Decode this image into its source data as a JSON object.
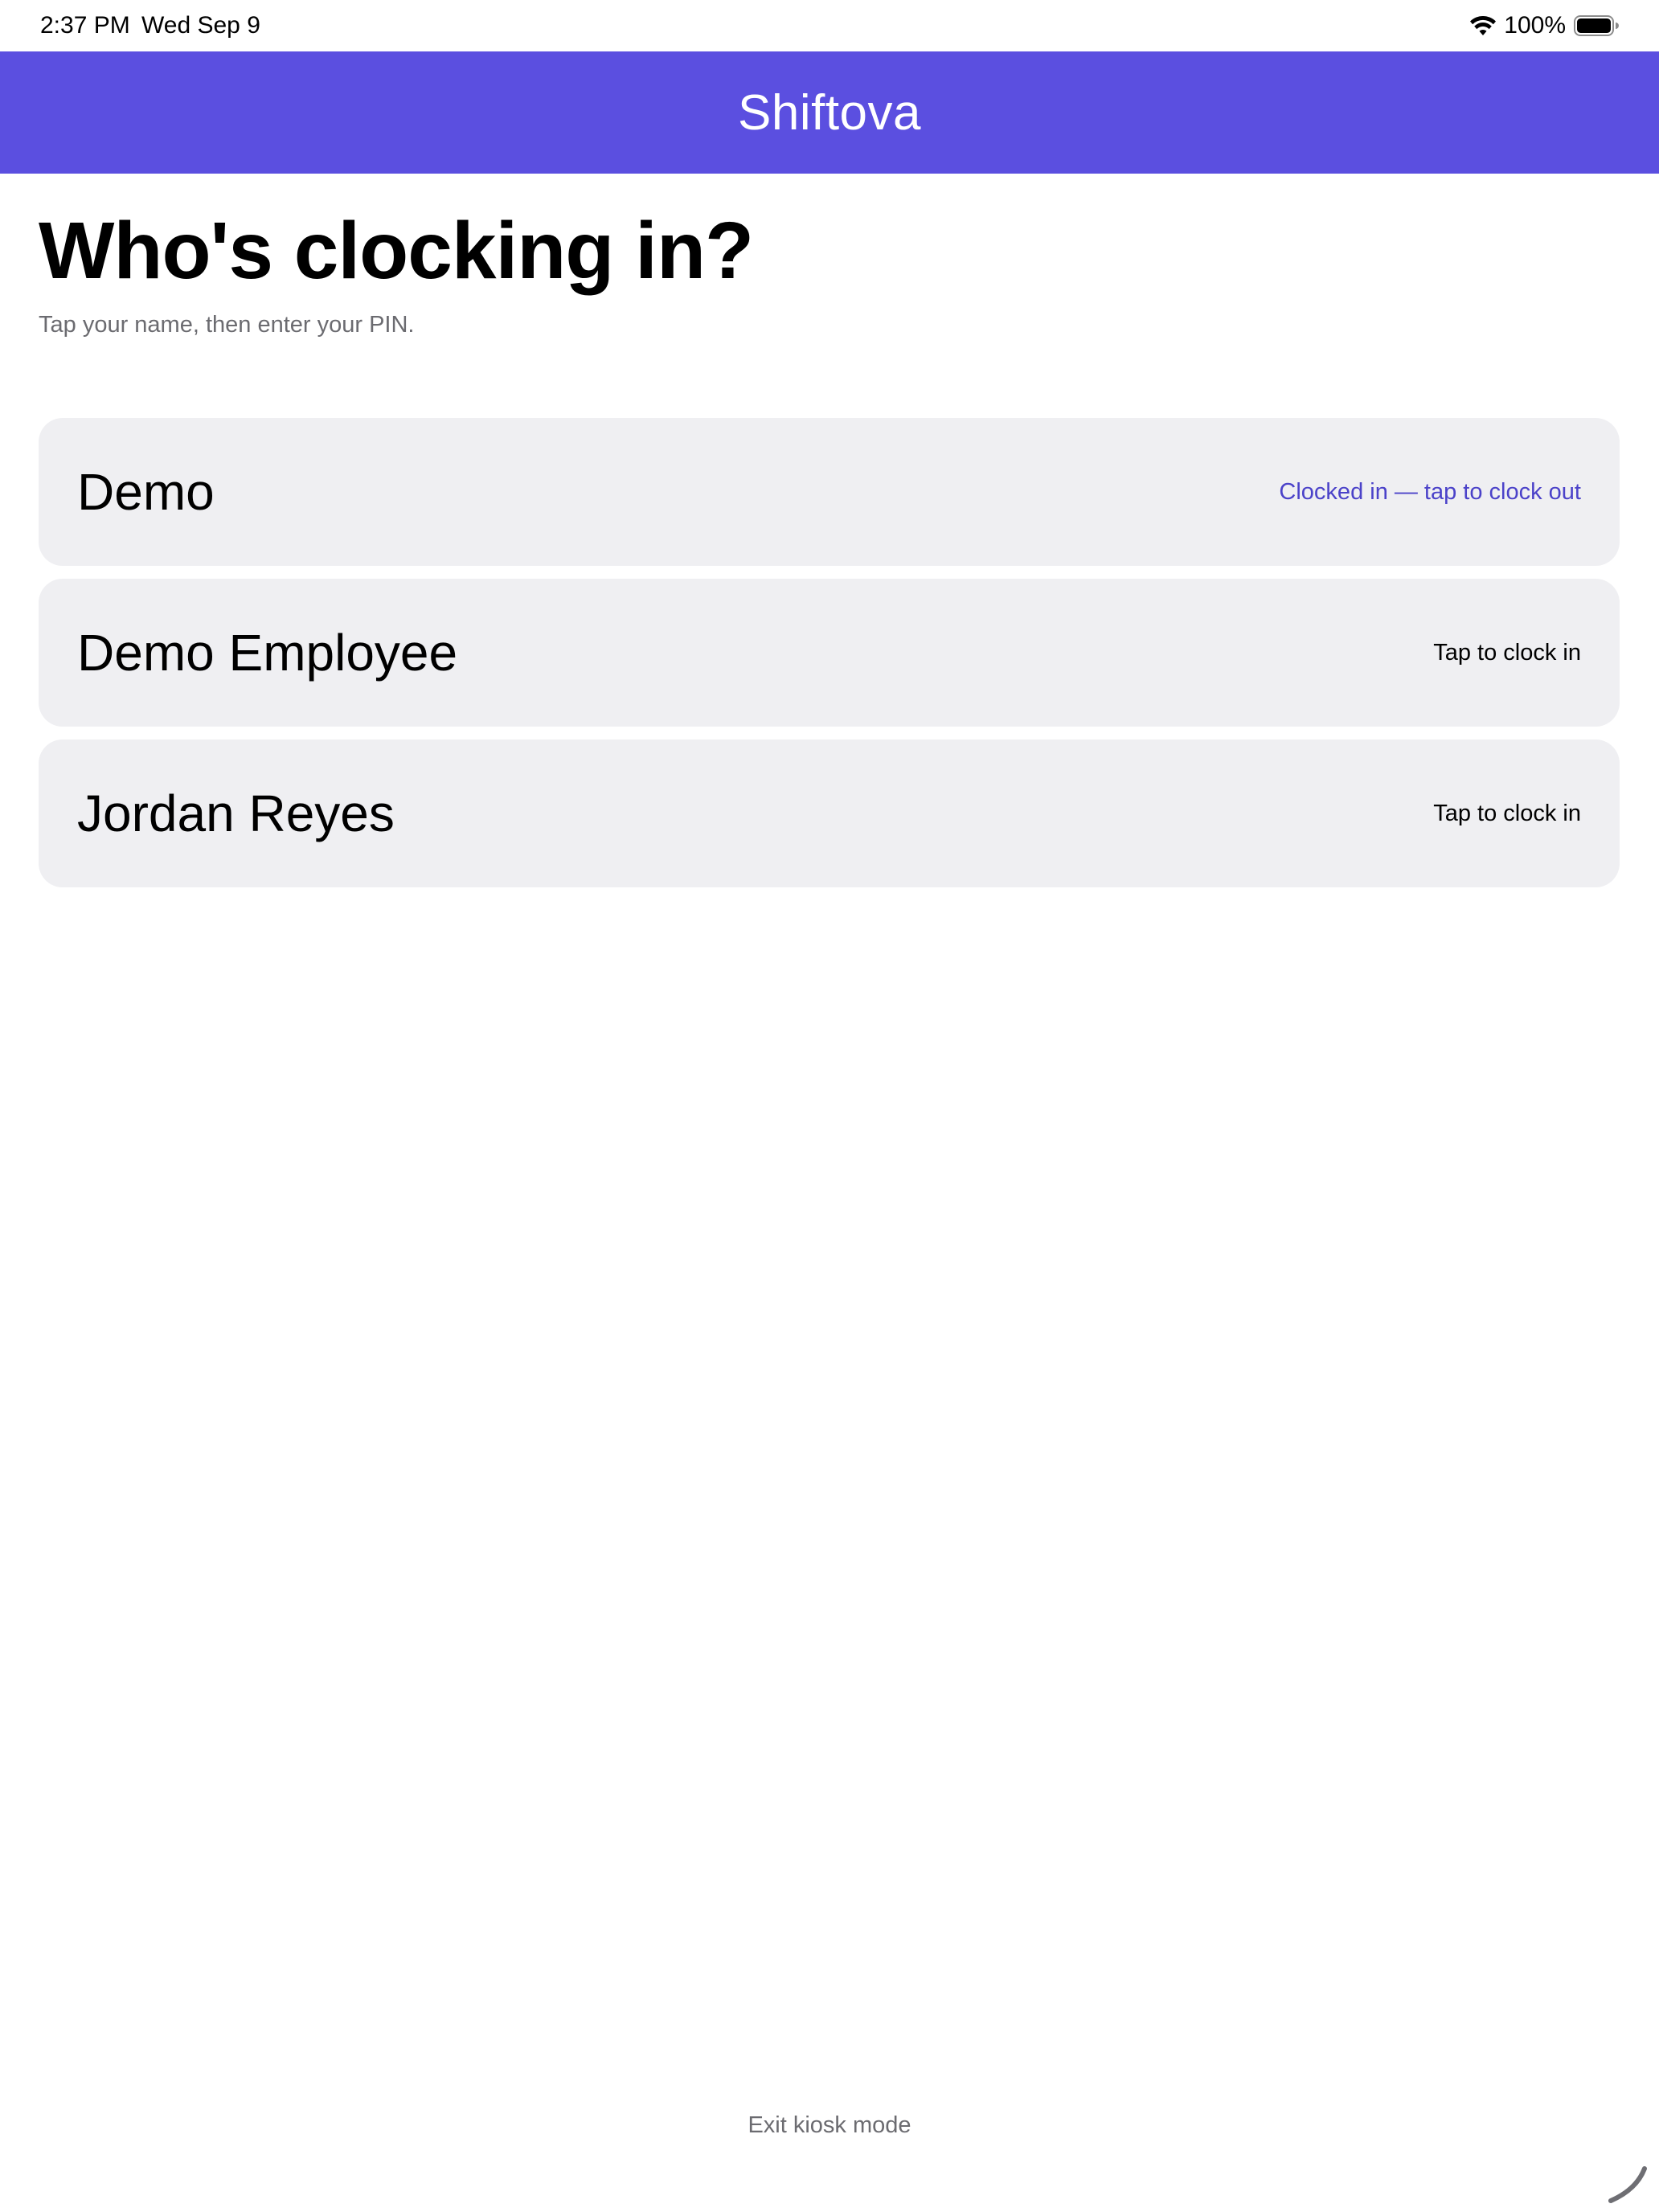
{
  "status_bar": {
    "time": "2:37 PM",
    "date": "Wed Sep 9",
    "battery_percent": "100%",
    "battery_level": 1.0,
    "icons": [
      "wifi-icon",
      "battery-icon"
    ]
  },
  "header": {
    "title": "Shiftova",
    "background_color": "#5b4fe0"
  },
  "main": {
    "title": "Who's clocking in?",
    "subtitle": "Tap your name, then enter your PIN."
  },
  "employees": [
    {
      "name": "Demo",
      "action": "Clocked in — tap to clock out",
      "clocked_in": true
    },
    {
      "name": "Demo Employee",
      "action": "Tap to clock in",
      "clocked_in": false
    },
    {
      "name": "Jordan Reyes",
      "action": "Tap to clock in",
      "clocked_in": false
    }
  ],
  "footer": {
    "exit_label": "Exit kiosk mode"
  },
  "colors": {
    "accent": "#5b4fe0",
    "clocked_in_text": "#4b42c9",
    "card_background": "#efeff2",
    "secondary_text": "#6b6b70"
  }
}
